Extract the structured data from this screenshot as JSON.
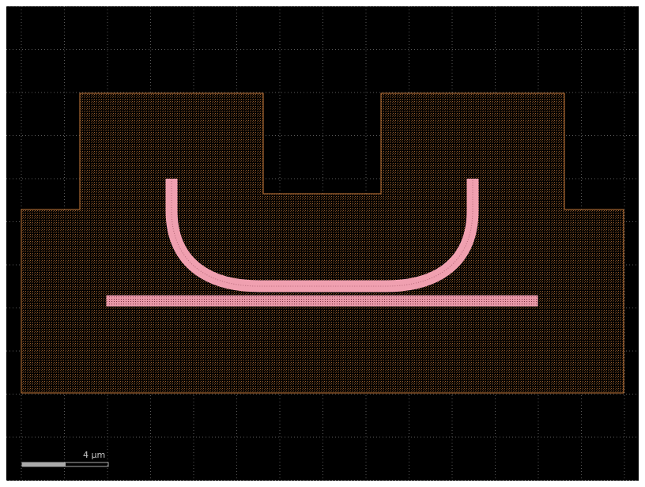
{
  "viewer": {
    "background_color": "#000000",
    "grid_color": "#5a5a5a",
    "cladding_color": "#c87a3a",
    "waveguide_color": "#f0a0b0"
  },
  "scale_bar": {
    "label": "4 µm"
  },
  "layout": {
    "components": [
      {
        "name": "cladding-region",
        "shape": "stepped-outline"
      },
      {
        "name": "ring-bend-waveguide",
        "shape": "u-bend"
      },
      {
        "name": "bus-waveguide",
        "shape": "straight"
      }
    ]
  }
}
